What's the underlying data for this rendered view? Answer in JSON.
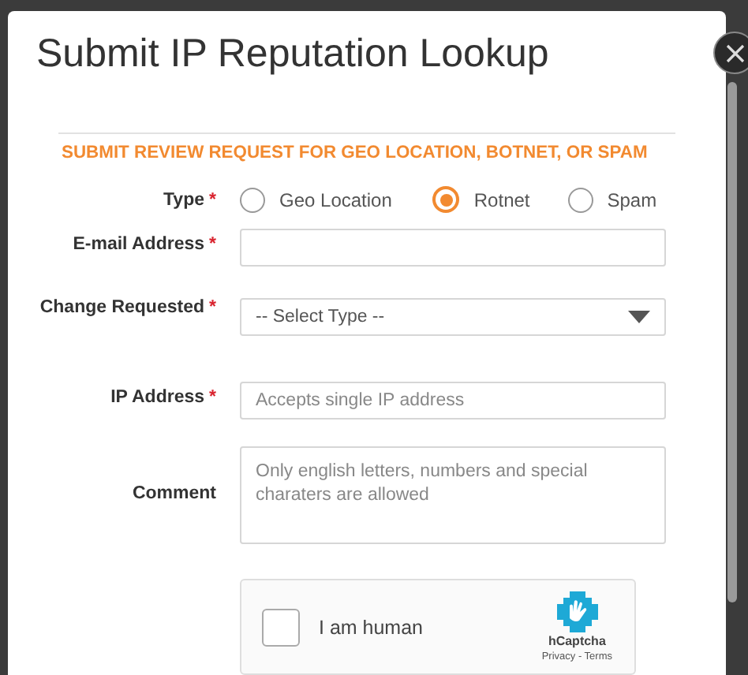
{
  "dialog": {
    "title": "Submit IP Reputation Lookup"
  },
  "section_heading": "SUBMIT REVIEW REQUEST FOR GEO LOCATION, BOTNET, OR SPAM",
  "fields": [
    {
      "kind": "radio",
      "label": "Type",
      "required_marker": "*",
      "options": [
        {
          "label": "Geo Location",
          "selected": false
        },
        {
          "label": "Rotnet",
          "selected": true
        },
        {
          "label": "Spam",
          "selected": false
        }
      ]
    },
    {
      "kind": "text",
      "label": "E-mail Address",
      "required_marker": "*"
    },
    {
      "kind": "select",
      "label": "Change Requested",
      "required_marker": "*",
      "value": "-- Select Type --"
    },
    {
      "kind": "text",
      "label": "IP Address",
      "required_marker": "*",
      "placeholder": "Accepts single IP address"
    },
    {
      "kind": "textarea",
      "label": "Comment",
      "placeholder": "Only english letters, numbers and special charaters are allowed"
    }
  ],
  "captcha": {
    "checked": false,
    "label": "I am human",
    "brand": "hCaptcha",
    "links": "Privacy - Terms"
  }
}
